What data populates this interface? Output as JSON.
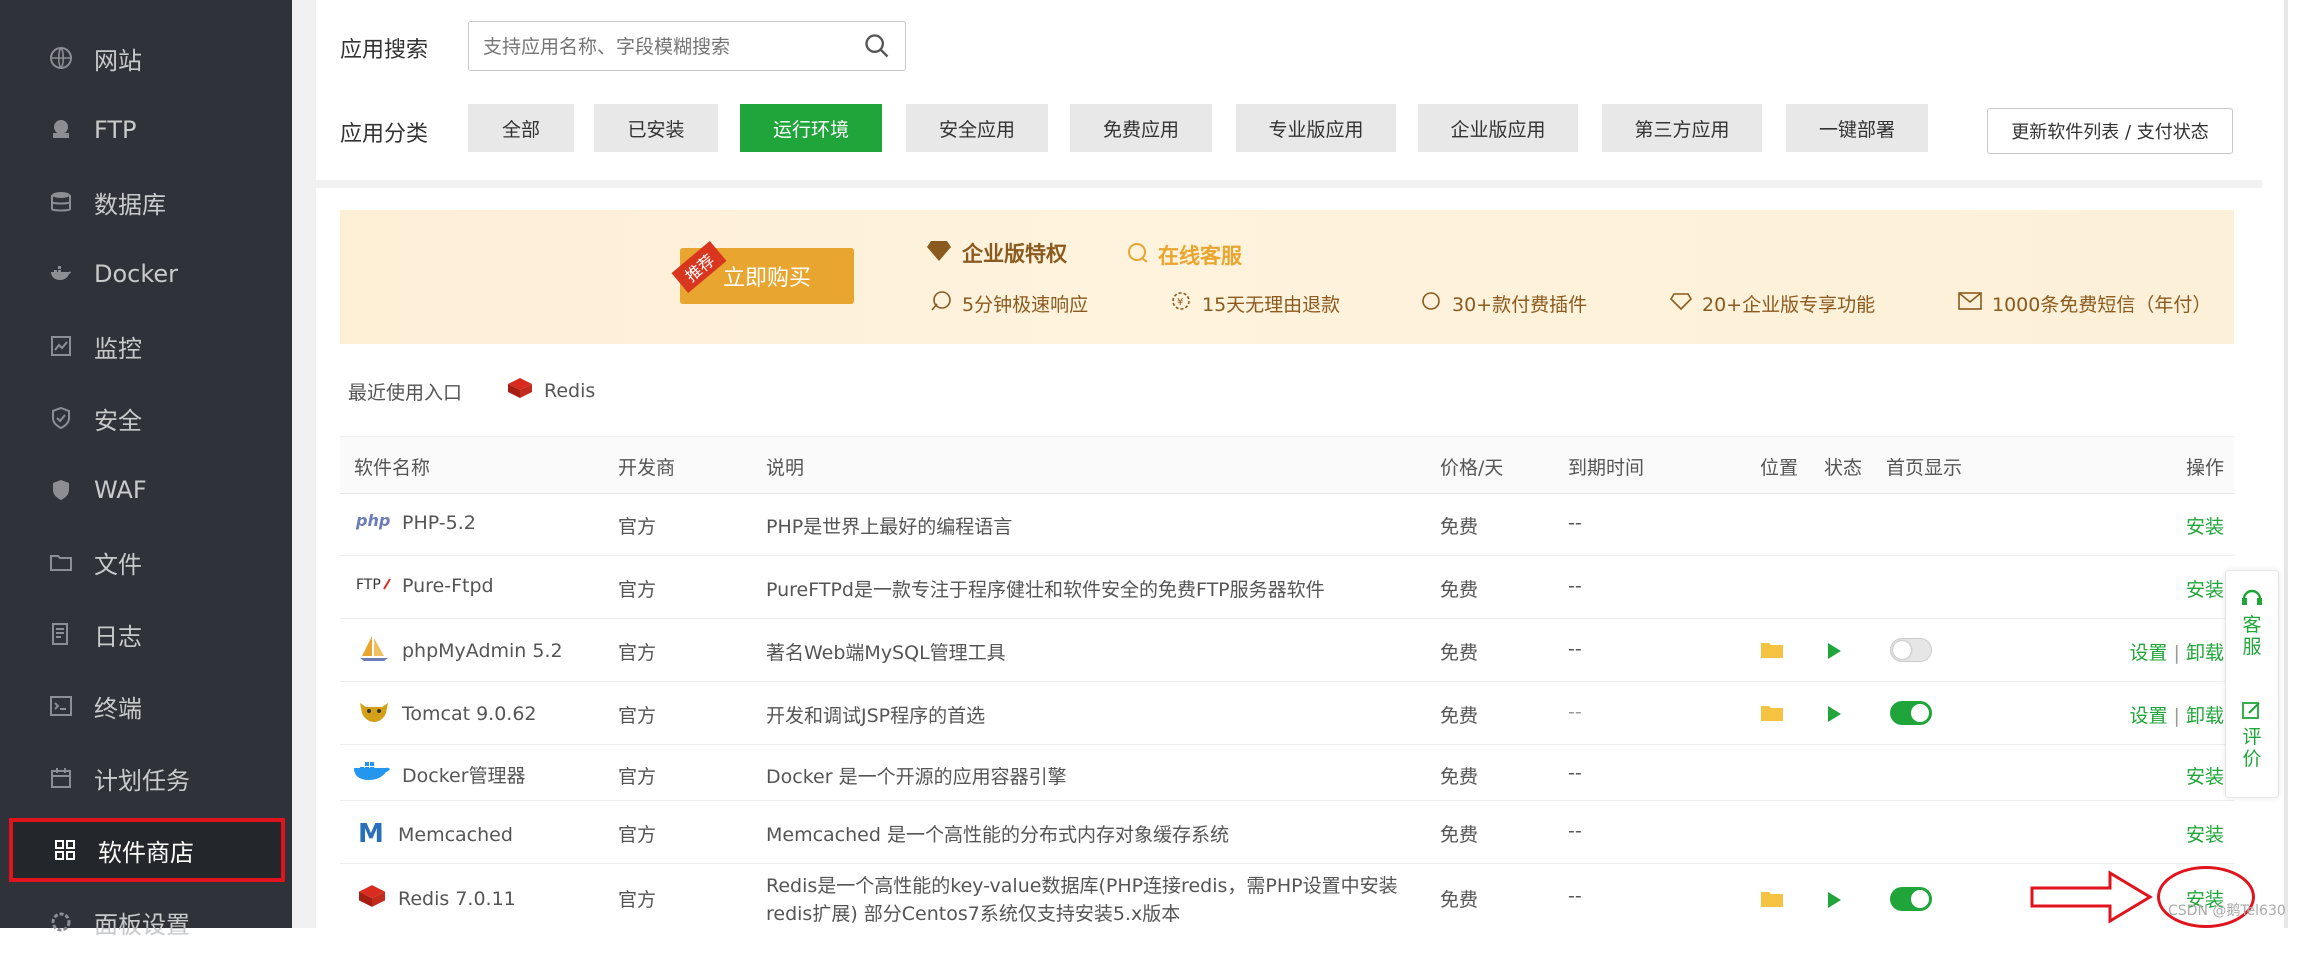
{
  "sidebar": {
    "items": [
      {
        "label": "网站",
        "icon": "globe-icon"
      },
      {
        "label": "FTP",
        "icon": "ftp-icon"
      },
      {
        "label": "数据库",
        "icon": "database-icon"
      },
      {
        "label": "Docker",
        "icon": "docker-icon"
      },
      {
        "label": "监控",
        "icon": "monitor-icon"
      },
      {
        "label": "安全",
        "icon": "shield-icon"
      },
      {
        "label": "WAF",
        "icon": "waf-icon"
      },
      {
        "label": "文件",
        "icon": "folder-icon"
      },
      {
        "label": "日志",
        "icon": "log-icon"
      },
      {
        "label": "终端",
        "icon": "terminal-icon"
      },
      {
        "label": "计划任务",
        "icon": "calendar-icon"
      },
      {
        "label": "软件商店",
        "icon": "grid-icon"
      },
      {
        "label": "面板设置",
        "icon": "settings-icon"
      }
    ],
    "active_index": 11
  },
  "search": {
    "label": "应用搜索",
    "placeholder": "支持应用名称、字段模糊搜索"
  },
  "category": {
    "label": "应用分类",
    "items": [
      "全部",
      "已安装",
      "运行环境",
      "安全应用",
      "免费应用",
      "专业版应用",
      "企业版应用",
      "第三方应用",
      "一键部署"
    ],
    "active": "运行环境"
  },
  "update_button": "更新软件列表 / 支付状态",
  "banner": {
    "badge": "推荐",
    "buy": "立即购买",
    "enterprise": "企业版特权",
    "service": "在线客服",
    "features": [
      "5分钟极速响应",
      "15天无理由退款",
      "30+款付费插件",
      "20+企业版专享功能",
      "1000条免费短信（年付）"
    ]
  },
  "recent": {
    "label": "最近使用入口",
    "items": [
      "Redis"
    ]
  },
  "table": {
    "headers": {
      "name": "软件名称",
      "dev": "开发商",
      "desc": "说明",
      "price": "价格/天",
      "expire": "到期时间",
      "loc": "位置",
      "status": "状态",
      "home": "首页显示",
      "op": "操作"
    },
    "rows": [
      {
        "name": "PHP-5.2",
        "dev": "官方",
        "desc": "PHP是世界上最好的编程语言",
        "price": "免费",
        "expire": "--",
        "op": "安装",
        "installed": false
      },
      {
        "name": "Pure-Ftpd",
        "dev": "官方",
        "desc": "PureFTPd是一款专注于程序健壮和软件安全的免费FTP服务器软件",
        "price": "免费",
        "expire": "--",
        "op": "安装",
        "installed": false
      },
      {
        "name": "phpMyAdmin 5.2",
        "dev": "官方",
        "desc": "著名Web端MySQL管理工具",
        "price": "免费",
        "expire": "--",
        "op1": "设置",
        "op2": "卸载",
        "installed": true,
        "home": false
      },
      {
        "name": "Tomcat 9.0.62",
        "dev": "官方",
        "desc": "开发和调试JSP程序的首选",
        "price": "免费",
        "expire": "--",
        "op1": "设置",
        "op2": "卸载",
        "installed": true,
        "home": true
      },
      {
        "name": "Docker管理器",
        "dev": "官方",
        "desc": "Docker 是一个开源的应用容器引擎",
        "price": "免费",
        "expire": "--",
        "op": "安装",
        "installed": false
      },
      {
        "name": "Memcached",
        "dev": "官方",
        "desc": "Memcached 是一个高性能的分布式内存对象缓存系统",
        "price": "免费",
        "expire": "--",
        "op": "安装",
        "installed": false
      },
      {
        "name": "Redis 7.0.11",
        "dev": "官方",
        "desc_line1": "Redis是一个高性能的key-value数据库(PHP连接redis，需PHP设置中安装",
        "desc_line2": "redis扩展) 部分Centos7系统仅支持安装5.x版本",
        "price": "免费",
        "expire": "--",
        "op": "安装",
        "installed": true,
        "home": true
      }
    ],
    "separator": "|"
  },
  "float_panel": {
    "service": "客服",
    "review": "评价"
  },
  "watermark": "CSDN @鹅Tel630",
  "colors": {
    "sidebar_bg": "#2f3238",
    "accent": "#20a53a",
    "highlight": "#e0141c",
    "banner_buy": "#e8a530"
  }
}
